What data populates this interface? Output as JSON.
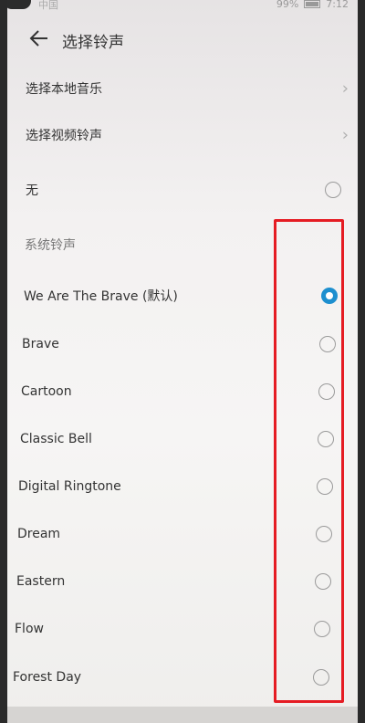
{
  "status": {
    "carrier": "中国",
    "battery": "99%",
    "time": "7:12"
  },
  "header": {
    "title": "选择铃声"
  },
  "options": {
    "local_music": "选择本地音乐",
    "video_ringtone": "选择视频铃声",
    "none": "无"
  },
  "section": {
    "system_ringtones": "系统铃声"
  },
  "ringtones": [
    {
      "label": "We Are The Brave (默认)",
      "selected": true
    },
    {
      "label": "Brave",
      "selected": false
    },
    {
      "label": "Cartoon",
      "selected": false
    },
    {
      "label": "Classic Bell",
      "selected": false
    },
    {
      "label": "Digital Ringtone",
      "selected": false
    },
    {
      "label": "Dream",
      "selected": false
    },
    {
      "label": "Eastern",
      "selected": false
    },
    {
      "label": "Flow",
      "selected": false
    },
    {
      "label": "Forest Day",
      "selected": false
    }
  ],
  "colors": {
    "accent": "#1d8fcf",
    "highlight_box": "#e51c23"
  }
}
